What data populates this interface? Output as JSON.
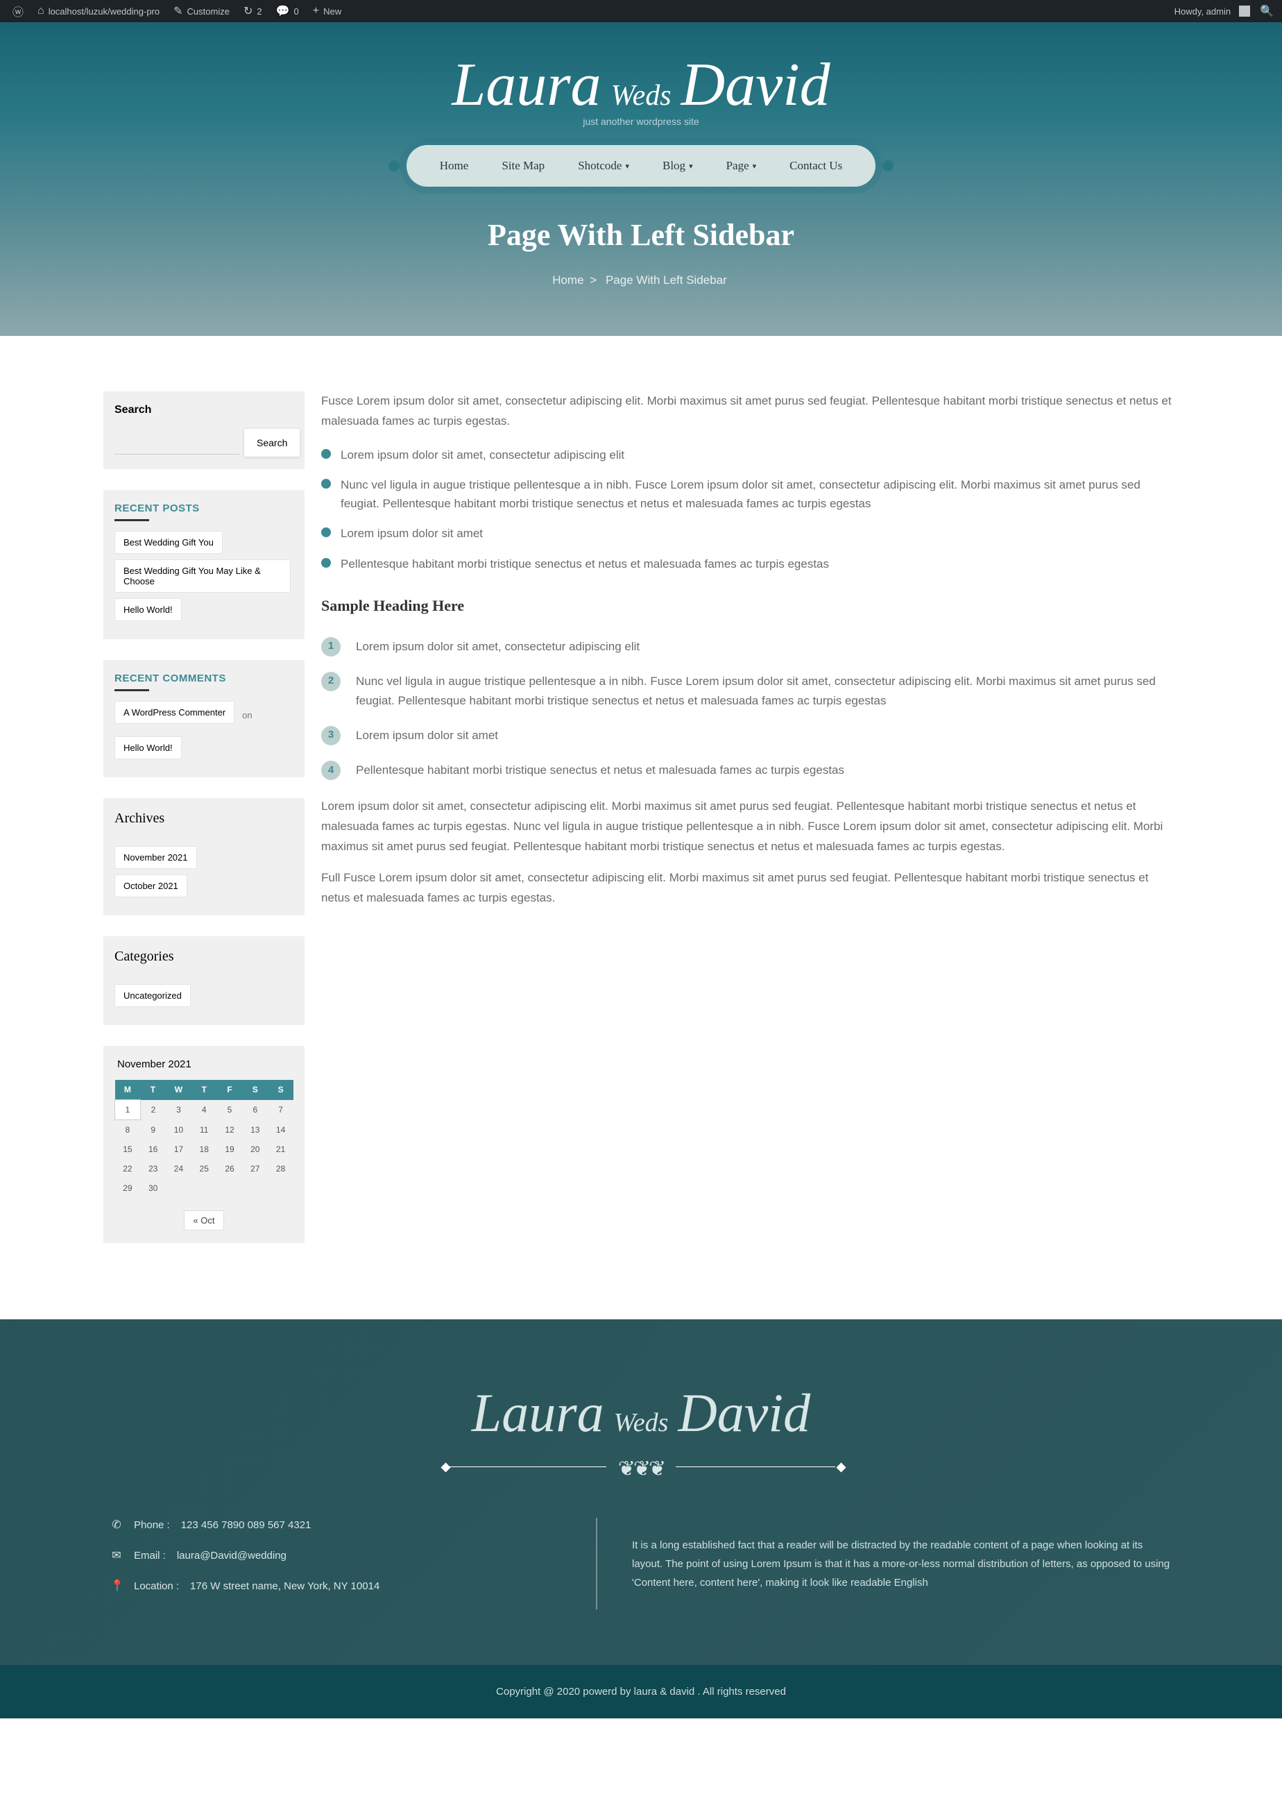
{
  "admin": {
    "site": "localhost/luzuk/wedding-pro",
    "customize": "Customize",
    "revisions": "2",
    "comments": "0",
    "new": "New",
    "howdy": "Howdy, admin"
  },
  "brand": {
    "left": "Laura",
    "mid": "Weds",
    "right": "David",
    "tagline": "just another wordpress site"
  },
  "nav": [
    {
      "label": "Home",
      "sub": false
    },
    {
      "label": "Site Map",
      "sub": false
    },
    {
      "label": "Shotcode",
      "sub": true
    },
    {
      "label": "Blog",
      "sub": true
    },
    {
      "label": "Page",
      "sub": true
    },
    {
      "label": "Contact Us",
      "sub": false
    }
  ],
  "page_title": "Page With Left Sidebar",
  "crumb": {
    "home": "Home",
    "sep": ">",
    "current": "Page With Left Sidebar"
  },
  "sidebar": {
    "search": {
      "title": "Search",
      "btn": "Search"
    },
    "recent_posts": {
      "title": "RECENT POSTS",
      "items": [
        "Best Wedding Gift You",
        "Best Wedding Gift You May Like & Choose",
        "Hello World!"
      ]
    },
    "recent_comments": {
      "title": "RECENT COMMENTS",
      "items": [
        {
          "author": "A WordPress Commenter",
          "on": "on",
          "post": "Hello World!"
        }
      ]
    },
    "archives": {
      "title": "Archives",
      "items": [
        "November 2021",
        "October 2021"
      ]
    },
    "categories": {
      "title": "Categories",
      "items": [
        "Uncategorized"
      ]
    },
    "calendar": {
      "caption": "November 2021",
      "days": [
        "M",
        "T",
        "W",
        "T",
        "F",
        "S",
        "S"
      ],
      "weeks": [
        [
          "1",
          "2",
          "3",
          "4",
          "5",
          "6",
          "7"
        ],
        [
          "8",
          "9",
          "10",
          "11",
          "12",
          "13",
          "14"
        ],
        [
          "15",
          "16",
          "17",
          "18",
          "19",
          "20",
          "21"
        ],
        [
          "22",
          "23",
          "24",
          "25",
          "26",
          "27",
          "28"
        ],
        [
          "29",
          "30",
          "",
          "",
          "",
          "",
          ""
        ]
      ],
      "active": "1",
      "prev": "« Oct"
    }
  },
  "content": {
    "intro": "Fusce Lorem ipsum dolor sit amet, consectetur adipiscing elit. Morbi maximus sit amet purus sed feugiat. Pellentesque habitant morbi tristique senectus et netus et malesuada fames ac turpis egestas.",
    "bullets": [
      "Lorem ipsum dolor sit amet, consectetur adipiscing elit",
      "Nunc vel ligula in augue tristique pellentesque a in nibh. Fusce Lorem ipsum dolor sit amet, consectetur adipiscing elit. Morbi maximus sit amet purus sed feugiat. Pellentesque habitant morbi tristique senectus et netus et malesuada fames ac turpis egestas",
      "Lorem ipsum dolor sit amet",
      "Pellentesque habitant morbi tristique senectus et netus et malesuada fames ac turpis egestas"
    ],
    "heading": "Sample Heading Here",
    "ol": [
      "Lorem ipsum dolor sit amet, consectetur adipiscing elit",
      "Nunc vel ligula in augue tristique pellentesque a in nibh. Fusce Lorem ipsum dolor sit amet, consectetur adipiscing elit. Morbi maximus sit amet purus sed feugiat. Pellentesque habitant morbi tristique senectus et netus et malesuada fames ac turpis egestas",
      "Lorem ipsum dolor sit amet",
      "Pellentesque habitant morbi tristique senectus et netus et malesuada fames ac turpis egestas"
    ],
    "p2": "Lorem ipsum dolor sit amet, consectetur adipiscing elit. Morbi maximus sit amet purus sed feugiat. Pellentesque habitant morbi tristique senectus et netus et malesuada fames ac turpis egestas. Nunc vel ligula in augue tristique pellentesque a in nibh. Fusce Lorem ipsum dolor sit amet, consectetur adipiscing elit. Morbi maximus sit amet purus sed feugiat. Pellentesque habitant morbi tristique senectus et netus et malesuada fames ac turpis egestas.",
    "p3": "Full Fusce Lorem ipsum dolor sit amet, consectetur adipiscing elit. Morbi maximus sit amet purus sed feugiat. Pellentesque habitant morbi tristique senectus et netus et malesuada fames ac turpis egestas."
  },
  "footer": {
    "phone_label": "Phone :",
    "phone": "123 456 7890 089 567 4321",
    "email_label": "Email :",
    "email": "laura@David@wedding",
    "loc_label": "Location :",
    "loc": "176 W street name, New York, NY 10014",
    "about": "It is a long established fact that a reader will be distracted by the readable content of a page when looking at its layout. The point of using Lorem Ipsum is that it has a more-or-less normal distribution of letters, as opposed to using 'Content here, content here', making it look like readable English",
    "copyright": "Copyright @ 2020 powerd by laura & david . All rights reserved"
  }
}
